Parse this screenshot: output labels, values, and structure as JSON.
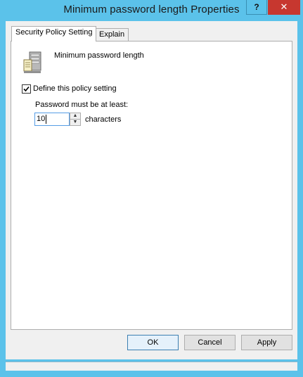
{
  "window": {
    "title": "Minimum password length Properties",
    "help_label": "?",
    "close_label": "✕"
  },
  "tabs": [
    {
      "label": "Security Policy Setting",
      "active": true
    },
    {
      "label": "Explain",
      "active": false
    }
  ],
  "policy": {
    "name": "Minimum password length",
    "icon": "policy-server-icon",
    "define_label": "Define this policy setting",
    "define_checked": true,
    "min_label": "Password must be at least:",
    "value": "10",
    "unit": "characters"
  },
  "buttons": {
    "ok": "OK",
    "cancel": "Cancel",
    "apply": "Apply"
  },
  "colors": {
    "frame": "#5bc2ea",
    "close": "#c7372f",
    "dialog": "#f0f0f0"
  }
}
